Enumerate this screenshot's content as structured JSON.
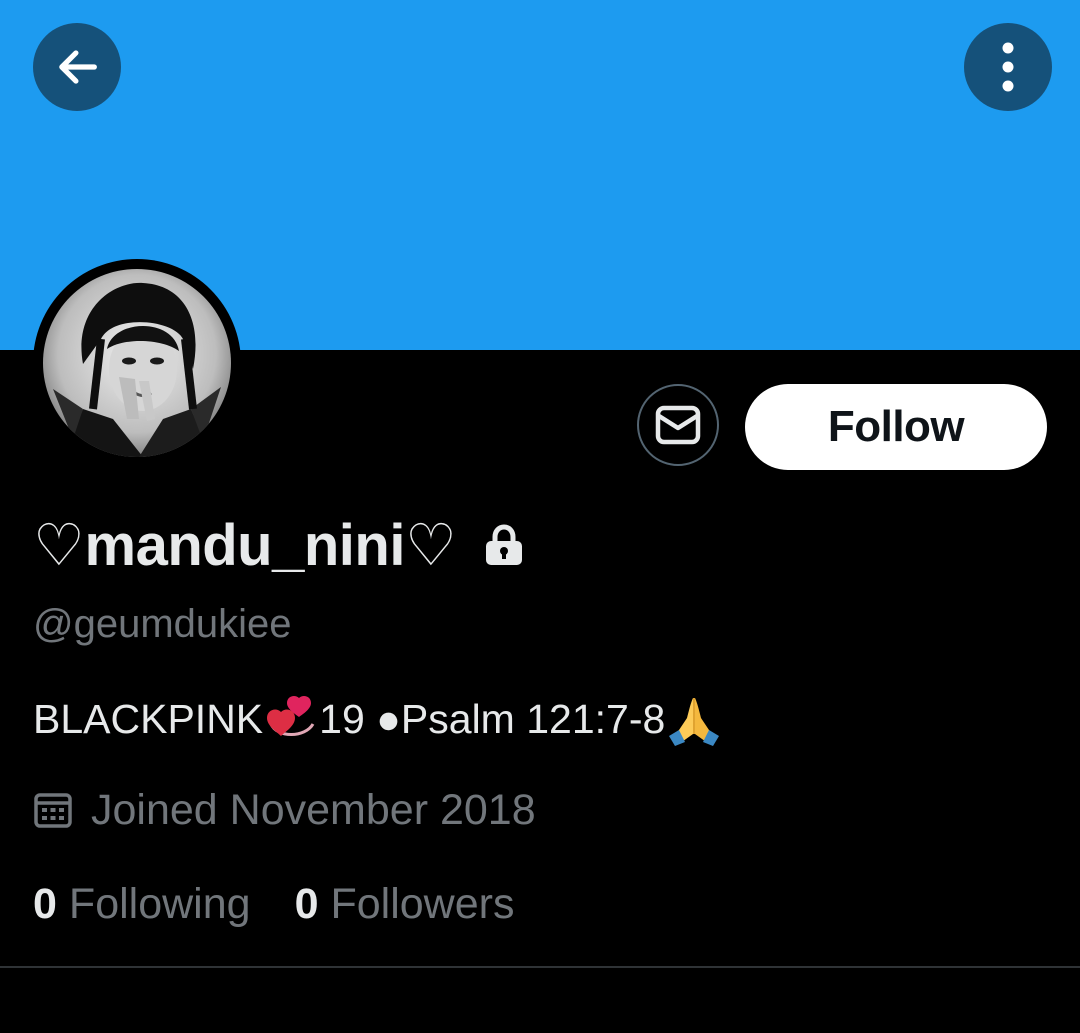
{
  "colors": {
    "banner": "#1d9bf0",
    "background": "#000000",
    "primary_text": "#e7e9ea",
    "secondary_text": "#71767b",
    "follow_button_bg": "#ffffff",
    "follow_button_text": "#0f1419"
  },
  "header": {
    "back_icon": "arrow-left-icon",
    "more_icon": "more-vertical-icon"
  },
  "profile": {
    "avatar_icon": "profile-avatar",
    "display_name": "♡mandu_nini♡",
    "protected_icon": "lock-icon",
    "handle": "@geumdukiee",
    "bio": {
      "part1": "BLACKPINK",
      "part2": " 19 ●Psalm 121:7-8",
      "emoji1": "revolving-hearts-icon",
      "emoji2": "folded-hands-icon"
    },
    "joined_icon": "calendar-icon",
    "joined": "Joined November 2018"
  },
  "actions": {
    "message_icon": "envelope-icon",
    "follow_label": "Follow"
  },
  "stats": {
    "following_count": "0",
    "following_label": "Following",
    "followers_count": "0",
    "followers_label": "Followers"
  }
}
